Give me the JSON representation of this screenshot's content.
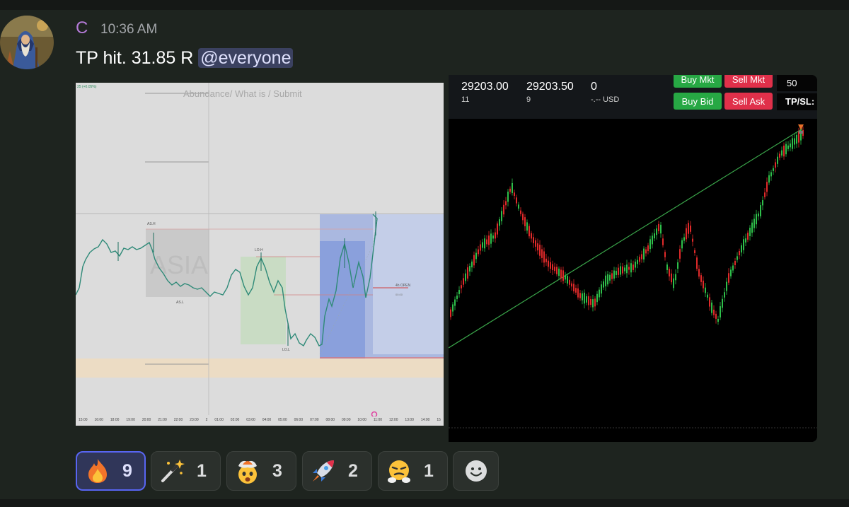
{
  "message": {
    "author": "C",
    "timestamp": "10:36 AM",
    "text": "TP hit. 31.85 R",
    "mention": "@everyone",
    "author_color": "#b57bd8"
  },
  "left_chart": {
    "header_text": "Abundance/ What is / Submit",
    "watermark": "ASIA",
    "tag_change": "25 (+0.05%)",
    "labels": {
      "asia_high": "AS.H",
      "asia_low": "AS.L",
      "london_high": "LO.H",
      "london_low": "LO.L",
      "open_4h": "4h OPEN",
      "open_value": "00.00"
    },
    "time_ticks": [
      "15:00",
      "16:00",
      "18:00",
      "19:00",
      "20:00",
      "21:00",
      "22:00",
      "23:00",
      "2",
      "01:00",
      "02:00",
      "03:00",
      "04:00",
      "05:00",
      "06:00",
      "07:00",
      "08:00",
      "09:00",
      "10:00",
      "11:00",
      "12:00",
      "13:00",
      "14:00",
      "15"
    ]
  },
  "trade_panel": {
    "bid_price": "29203.00",
    "bid_size": "11",
    "ask_price": "29203.50",
    "ask_size": "9",
    "position": "0",
    "position_currency": "-.-- USD",
    "buy_mkt": "Buy Mkt",
    "sell_mkt": "Sell Mkt",
    "buy_bid": "Buy Bid",
    "sell_ask": "Sell Ask",
    "quantity": "50",
    "tpsl": "TP/SL:"
  },
  "reactions": [
    {
      "emoji": "fire-emoji",
      "count": "9",
      "active": true
    },
    {
      "emoji": "magic-wand-emoji",
      "count": "1",
      "active": false
    },
    {
      "emoji": "exploding-head-emoji",
      "count": "3",
      "active": false
    },
    {
      "emoji": "rocket-emoji",
      "count": "2",
      "active": false
    },
    {
      "emoji": "steam-nose-emoji",
      "count": "1",
      "active": false
    }
  ],
  "add_reaction": "add-reaction-icon"
}
